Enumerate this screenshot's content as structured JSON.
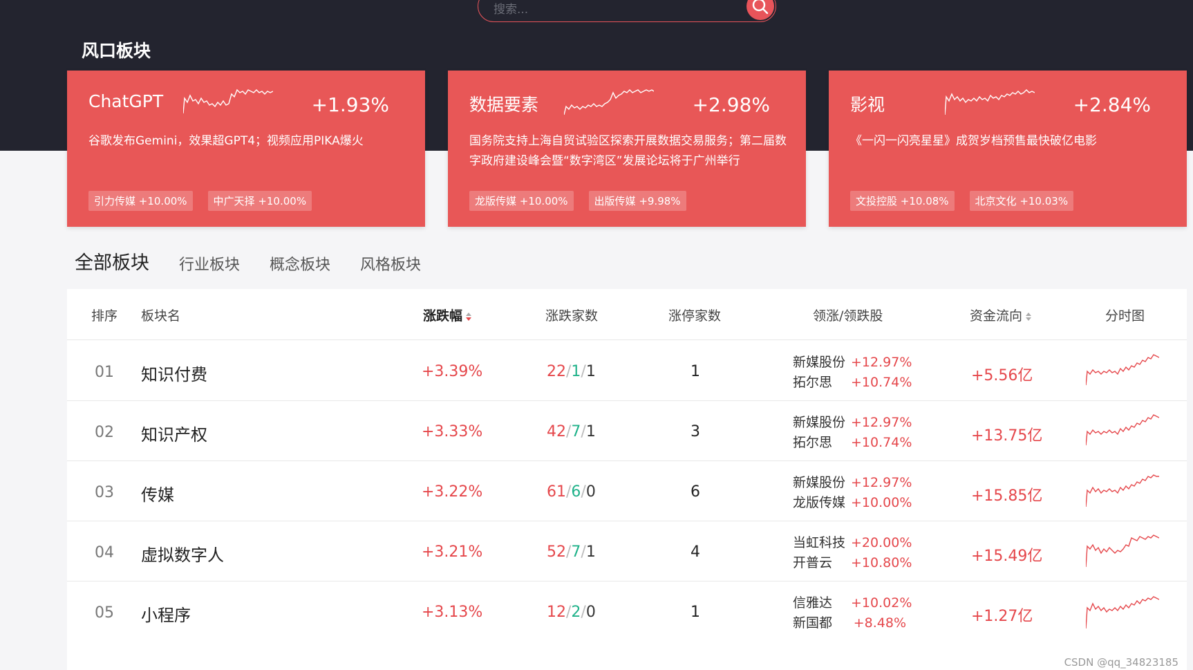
{
  "search": {
    "placeholder": "搜索..."
  },
  "page_title": "风口板块",
  "hot_sectors": [
    {
      "name": "ChatGPT",
      "change": "+1.93%",
      "desc": "谷歌发布Gemini，效果超GPT4；视频应用PIKA爆火",
      "tags": [
        "引力传媒 +10.00%",
        "中广天择 +10.00%"
      ]
    },
    {
      "name": "数据要素",
      "change": "+2.98%",
      "desc": "国务院支持上海自贸试验区探索开展数据交易服务；第二届数字政府建设峰会暨“数字湾区”发展论坛将于广州举行",
      "tags": [
        "龙版传媒 +10.00%",
        "出版传媒 +9.98%"
      ]
    },
    {
      "name": "影视",
      "change": "+2.84%",
      "desc": "《一闪一闪亮星星》成贺岁档预售最快破亿电影",
      "tags": [
        "文投控股 +10.08%",
        "北京文化 +10.03%"
      ]
    }
  ],
  "tabs": [
    "全部板块",
    "行业板块",
    "概念板块",
    "风格板块"
  ],
  "table": {
    "headers": {
      "rank": "排序",
      "name": "板块名",
      "change": "涨跌幅",
      "adv_dec": "涨跌家数",
      "limit_up": "涨停家数",
      "leaders": "领涨/领跌股",
      "flow": "资金流向",
      "chart": "分时图"
    },
    "rows": [
      {
        "rank": "01",
        "name": "知识付费",
        "change": "+3.39%",
        "up": "22",
        "down": "1",
        "flat": "1",
        "limit": "1",
        "lead1": "新媒股份",
        "lead1_pct": "+12.97%",
        "lead2": "拓尔思",
        "lead2_pct": "+10.74%",
        "flow": "+5.56亿"
      },
      {
        "rank": "02",
        "name": "知识产权",
        "change": "+3.33%",
        "up": "42",
        "down": "7",
        "flat": "1",
        "limit": "3",
        "lead1": "新媒股份",
        "lead1_pct": "+12.97%",
        "lead2": "拓尔思",
        "lead2_pct": "+10.74%",
        "flow": "+13.75亿"
      },
      {
        "rank": "03",
        "name": "传媒",
        "change": "+3.22%",
        "up": "61",
        "down": "6",
        "flat": "0",
        "limit": "6",
        "lead1": "新媒股份",
        "lead1_pct": "+12.97%",
        "lead2": "龙版传媒",
        "lead2_pct": "+10.00%",
        "flow": "+15.85亿"
      },
      {
        "rank": "04",
        "name": "虚拟数字人",
        "change": "+3.21%",
        "up": "52",
        "down": "7",
        "flat": "1",
        "limit": "4",
        "lead1": "当虹科技",
        "lead1_pct": "+20.00%",
        "lead2": "开普云",
        "lead2_pct": "+10.80%",
        "flow": "+15.49亿"
      },
      {
        "rank": "05",
        "name": "小程序",
        "change": "+3.13%",
        "up": "12",
        "down": "2",
        "flat": "0",
        "limit": "1",
        "lead1": "信雅达",
        "lead1_pct": "+10.02%",
        "lead2": "新国都",
        "lead2_pct": "+8.48%",
        "flow": "+1.27亿"
      }
    ]
  },
  "watermark": "CSDN @qq_34823185",
  "colors": {
    "header_bg": "#23242f",
    "card_bg": "#e85757",
    "up": "#e5474b",
    "down": "#20b28a"
  }
}
